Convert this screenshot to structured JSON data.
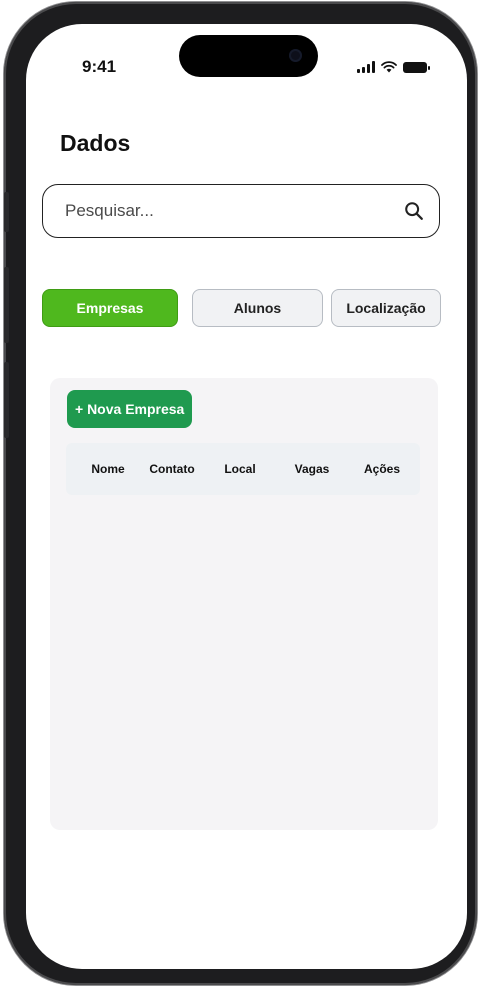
{
  "status_bar": {
    "time": "9:41"
  },
  "page": {
    "title": "Dados"
  },
  "search": {
    "placeholder": "Pesquisar..."
  },
  "tabs": [
    {
      "label": "Empresas",
      "active": true
    },
    {
      "label": "Alunos",
      "active": false
    },
    {
      "label": "Localização",
      "active": false
    }
  ],
  "panel": {
    "new_button_label": "+ Nova Empresa",
    "table": {
      "columns": [
        "Nome",
        "Contato",
        "Local",
        "Vagas",
        "Ações"
      ],
      "rows": []
    }
  },
  "colors": {
    "accent_active_tab": "#4fb81e",
    "new_button": "#1f9a4f",
    "panel_bg": "#f5f4f6",
    "table_header_bg": "#eef1f4"
  },
  "icons": [
    "search-icon",
    "signal-icon",
    "wifi-icon",
    "battery-icon"
  ]
}
